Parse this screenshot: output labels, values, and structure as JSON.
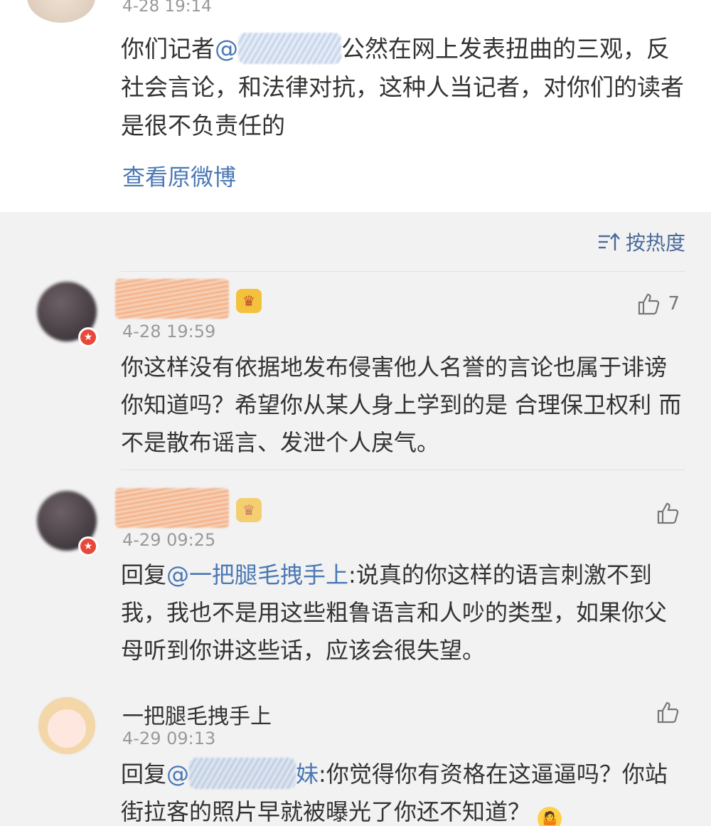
{
  "post": {
    "time": "4-28 19:14",
    "mention_prefix": "你们记者",
    "mention_at": "@",
    "text_after": "公然在网上发表扭曲的三观，反社会言论，和法律对抗，这种人当记者，对你们的读者是很不负责任的",
    "view_original": "查看原微博"
  },
  "sort": {
    "label": "按热度",
    "icon": "sort-icon"
  },
  "comments": [
    {
      "time": "4-28 19:59",
      "likes": "7",
      "text": "你这样没有依据地发布侵害他人名誉的言论也属于诽谤你知道吗？希望你从某人身上学到的是 合理保卫权利 而不是散布谣言、发泄个人戾气。"
    },
    {
      "time": "4-29 09:25",
      "reply_prefix": "回复",
      "reply_mention": "@一把腿毛拽手上",
      "text": ":说真的你这样的语言刺激不到我，我也不是用这些粗鲁语言和人吵的类型，如果你父母听到你讲这些话，应该会很失望。"
    },
    {
      "name": "一把腿毛拽手上",
      "time": "4-29 09:13",
      "reply_prefix": "回复",
      "reply_at": "@",
      "reply_visible_tail": "妹",
      "text": ":你觉得你有资格在这逼逼吗？你站街拉客的照片早就被曝光了你还不知道？"
    }
  ],
  "colors": {
    "link": "#4a78b4",
    "text": "#333333",
    "muted": "#999999",
    "badge": "#e8483a"
  }
}
